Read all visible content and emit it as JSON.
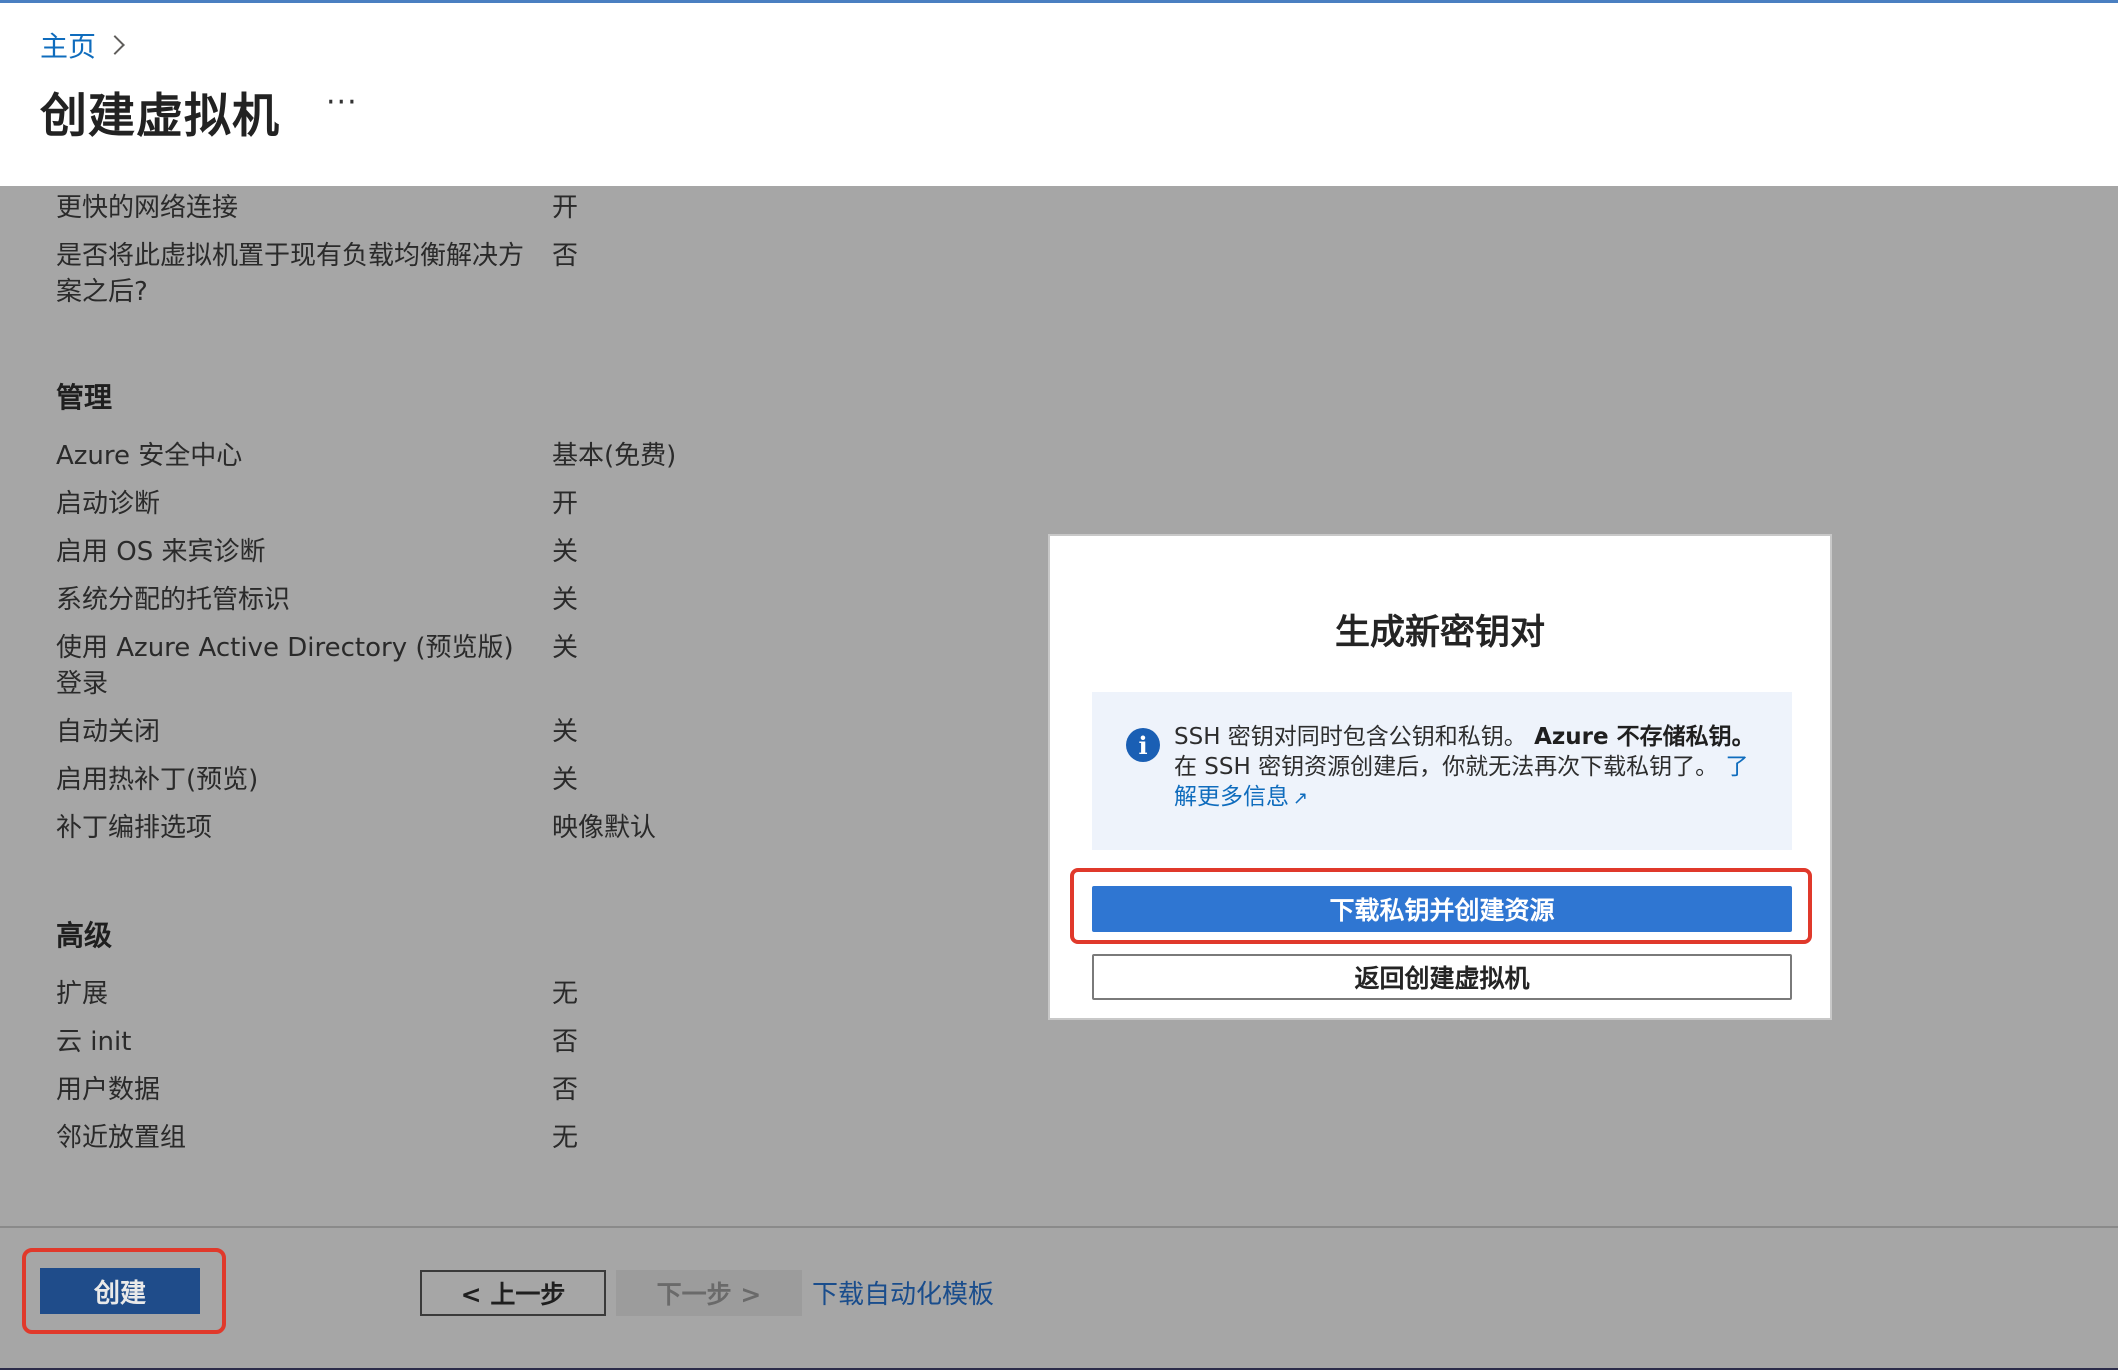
{
  "header": {
    "breadcrumb_home": "主页",
    "title": "创建虚拟机",
    "more": "···"
  },
  "network": {
    "rows": [
      {
        "label": "更快的网络连接",
        "value": "开"
      },
      {
        "label": "是否将此虚拟机置于现有负载均衡解决方案之后?",
        "value": "否"
      }
    ]
  },
  "management": {
    "title": "管理",
    "rows": [
      {
        "label": "Azure 安全中心",
        "value": "基本(免费)"
      },
      {
        "label": "启动诊断",
        "value": "开"
      },
      {
        "label": "启用 OS 来宾诊断",
        "value": "关"
      },
      {
        "label": "系统分配的托管标识",
        "value": "关"
      },
      {
        "label": "使用 Azure Active Directory (预览版)登录",
        "value": "关"
      },
      {
        "label": "自动关闭",
        "value": "关"
      },
      {
        "label": "启用热补丁(预览)",
        "value": "关"
      },
      {
        "label": "补丁编排选项",
        "value": "映像默认"
      }
    ]
  },
  "advanced": {
    "title": "高级",
    "rows": [
      {
        "label": "扩展",
        "value": "无"
      },
      {
        "label": "云 init",
        "value": "否"
      },
      {
        "label": "用户数据",
        "value": "否"
      },
      {
        "label": "邻近放置组",
        "value": "无"
      }
    ]
  },
  "footer": {
    "create": "创建",
    "prev": "< 上一步",
    "next": "下一步 >",
    "download_template": "下载自动化模板"
  },
  "modal": {
    "title": "生成新密钥对",
    "info_text_1": "SSH 密钥对同时包含公钥和私钥。",
    "info_bold": "Azure 不存储私钥。",
    "info_text_2": "在 SSH 密钥资源创建后，你就无法再次下载私钥了。",
    "info_link": "了解更多信息",
    "download_button": "下载私钥并创建资源",
    "back_button": "返回创建虚拟机"
  },
  "colors": {
    "overlay": "#a6a6a6",
    "primary": "#2f76d2",
    "highlight": "#e0392b",
    "link": "#0f6cbd"
  }
}
